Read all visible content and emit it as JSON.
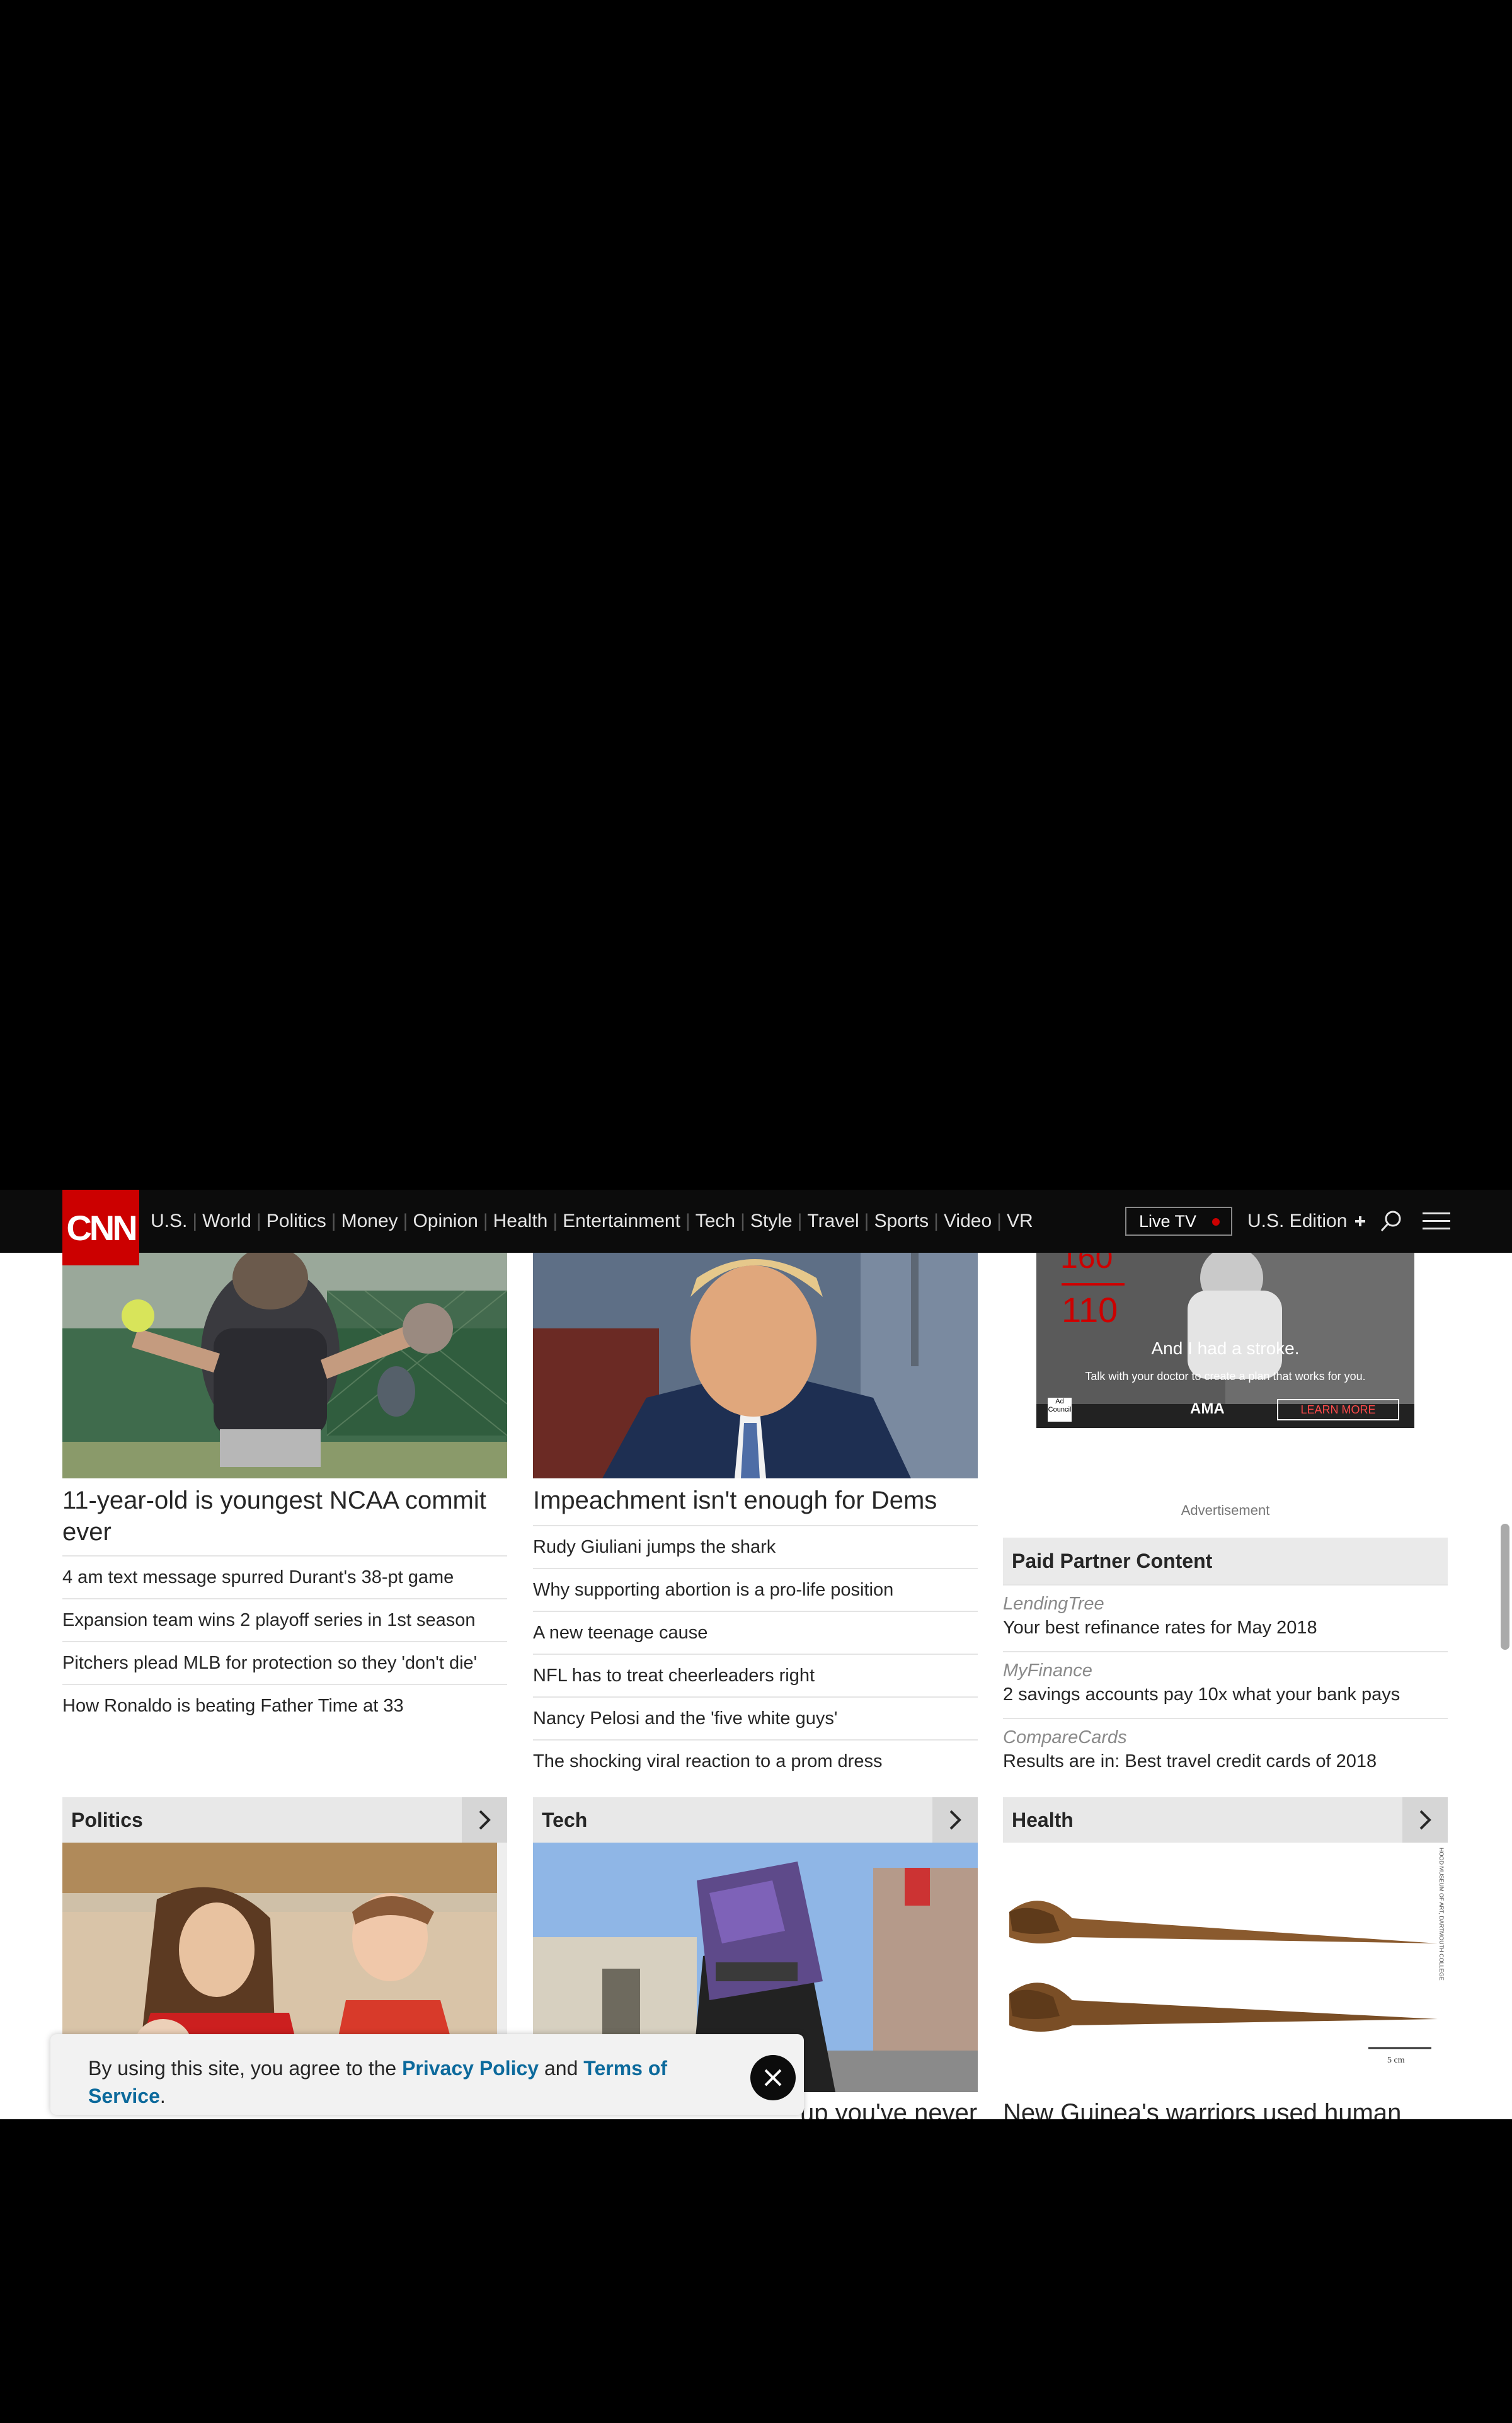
{
  "nav": {
    "logo": "CNN",
    "links": [
      "U.S.",
      "World",
      "Politics",
      "Money",
      "Opinion",
      "Health",
      "Entertainment",
      "Tech",
      "Style",
      "Travel",
      "Sports",
      "Video",
      "VR"
    ],
    "live_tv": "Live TV",
    "edition": "U.S. Edition"
  },
  "sports": {
    "headline": "11-year-old is youngest NCAA commit ever",
    "items": [
      "4 am text message spurred Durant's 38-pt game",
      "Expansion team wins 2 playoff series in 1st season",
      "Pitchers plead MLB for protection so they 'don't die'",
      "How Ronaldo is beating Father Time at 33"
    ]
  },
  "opinion": {
    "headline": "Impeachment isn't enough for Dems",
    "items": [
      "Rudy Giuliani jumps the shark",
      "Why supporting abortion is a pro-life position",
      "A new teenage cause",
      "NFL has to treat cheerleaders right",
      "Nancy Pelosi and the 'five white guys'",
      "The shocking viral reaction to a prom dress"
    ]
  },
  "ad": {
    "tagline": "And I had a stroke.",
    "subline": "Talk with your doctor to create a plan that works for you.",
    "numbers_top": "160",
    "numbers_bottom": "110",
    "cta": "LEARN MORE",
    "badge1": "Ad Council",
    "badge2": "AMA",
    "label": "Advertisement"
  },
  "paid": {
    "header": "Paid Partner Content",
    "items": [
      {
        "source": "LendingTree",
        "title": "Your best refinance rates for May 2018"
      },
      {
        "source": "MyFinance",
        "title": "2 savings accounts pay 10x what your bank pays"
      },
      {
        "source": "CompareCards",
        "title": "Results are in: Best travel credit cards of 2018"
      }
    ]
  },
  "sections": {
    "politics": "Politics",
    "tech": "Tech",
    "health": "Health"
  },
  "bottom": {
    "tech_partial": "up you've never",
    "health_partial": "New Guinea's warriors used human"
  },
  "health_image": {
    "scale": "5 cm",
    "credit": "HOOD MUSEUM OF ART, DARTMOUTH COLLEGE"
  },
  "consent": {
    "prefix": "By using this site, you agree to the ",
    "privacy": "Privacy Policy",
    "and": " and ",
    "terms": "Terms of Service",
    "suffix": "."
  },
  "colors": {
    "brand": "#cc0000",
    "nav_bg": "#0c0c0c",
    "link": "#0c6a9c"
  }
}
